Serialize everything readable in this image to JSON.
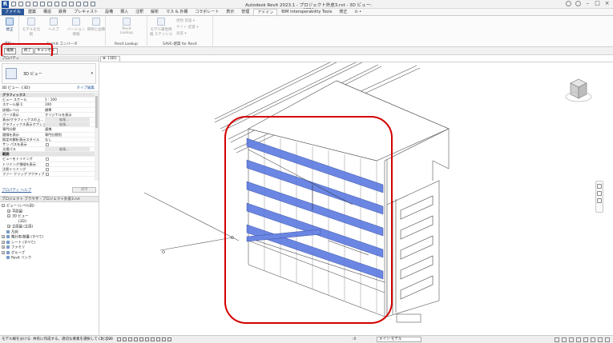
{
  "app": {
    "logo": "R",
    "window_title": "Autodesk Revit 2023.1 - プロジェクト外皮3.rvt - 3D ビュー: {3D}"
  },
  "ribbon": {
    "tabs": [
      "ファイル",
      "建築",
      "構造",
      "鉄骨",
      "プレキャスト",
      "設備",
      "挿入",
      "注釈",
      "解析",
      "マス & 外構",
      "コラボレート",
      "表示",
      "管理",
      "アドイン",
      "BIM Interoperability Tools",
      "修正",
      "⊙ •"
    ],
    "active_tab": "アドイン",
    "buttons": {
      "modify": "修正",
      "revit_model": "モデルを比較",
      "help": "ヘルプ",
      "version": "バージョン情報",
      "material_manager": "照明と画像",
      "revit_lookup": "Revit Lookup",
      "model_info": "モデル属性情報 ステンシル"
    },
    "group_labels": {
      "select": "選択 ▾",
      "formit": "FormIt コンバータ",
      "lookup": "Revit Lookup",
      "save": "SAVE-建築 for Revit"
    },
    "small_items": [
      "建物 管理 ▾",
      "サイト 配置 ▾",
      "高度 ▾"
    ]
  },
  "option_bar": {
    "buttons": [
      "複数",
      "終了",
      "キャンセル"
    ]
  },
  "properties": {
    "header": "プロパティ",
    "type_name": "3D ビュー",
    "instance_label": "3D ビュー: {3D}",
    "edit_type": "タイプ編集",
    "rows": [
      {
        "key": "グラフィックス",
        "value": "",
        "cat": true
      },
      {
        "key": "ビュー スケール",
        "value": "1 : 100"
      },
      {
        "key": "スケール値 1:",
        "value": "100"
      },
      {
        "key": "詳細レベル",
        "value": "標準"
      },
      {
        "key": "パーツ表示",
        "value": "オリジナルを表示"
      },
      {
        "key": "表示/グラフィックスの上...",
        "value": "",
        "button": "編集..."
      },
      {
        "key": "グラフィックス表示オプション",
        "value": "",
        "button": "編集..."
      },
      {
        "key": "専門分野",
        "value": "連携"
      },
      {
        "key": "隠線を表示",
        "value": "専門分野別"
      },
      {
        "key": "既定の解析表示スタイル",
        "value": "なし"
      },
      {
        "key": "サン パスを表示",
        "value": "",
        "check": true
      },
      {
        "key": "太陽パス",
        "value": "",
        "button": "編集..."
      },
      {
        "key": "範囲",
        "value": "",
        "cat": true
      },
      {
        "key": "ビューをトリミング",
        "value": "",
        "check": true
      },
      {
        "key": "トリミング領域を表示",
        "value": "",
        "check": true
      },
      {
        "key": "注釈トリミング",
        "value": "",
        "check": true
      },
      {
        "key": "ファー クリップ アクティブ",
        "value": "",
        "check": true
      }
    ],
    "help_link": "プロパティ ヘルプ",
    "apply": "適用"
  },
  "browser": {
    "header": "プロジェクト ブラウザ - プロジェクト外皮3.rvt",
    "tree": [
      {
        "label": "ビュー (レベル別)",
        "level": 0,
        "toggle": "−"
      },
      {
        "label": "平面図",
        "level": 1,
        "toggle": "+"
      },
      {
        "label": "3D ビュー",
        "level": 1,
        "toggle": "−"
      },
      {
        "label": "{3D}",
        "level": 2,
        "toggle": ""
      },
      {
        "label": "立面図 (立面)",
        "level": 1,
        "toggle": "+"
      },
      {
        "label": "凡例",
        "level": 0,
        "toggle": "",
        "icon": true
      },
      {
        "label": "集計表/数量 (すべて)",
        "level": 0,
        "toggle": "+",
        "icon": true
      },
      {
        "label": "シート (すべて)",
        "level": 0,
        "toggle": "+",
        "icon": true
      },
      {
        "label": "ファミリ",
        "level": 0,
        "toggle": "+",
        "icon": true
      },
      {
        "label": "グループ",
        "level": 0,
        "toggle": "+",
        "icon": true
      },
      {
        "label": "Revit リンク",
        "level": 0,
        "toggle": "",
        "icon": true
      }
    ]
  },
  "view": {
    "tab_label": "{3D}"
  },
  "status": {
    "text": "モデル線を分ける: 共有に作成する。適切な要素を選択してください",
    "scale": "1 : 100",
    "model_label": "メイン モデル",
    "selected": ":0",
    "model_dropdown": "メイン モデル"
  },
  "colors": {
    "highlight_red": "#d40000",
    "selection_blue": "#5b7be0",
    "file_tab": "#2b579a"
  }
}
